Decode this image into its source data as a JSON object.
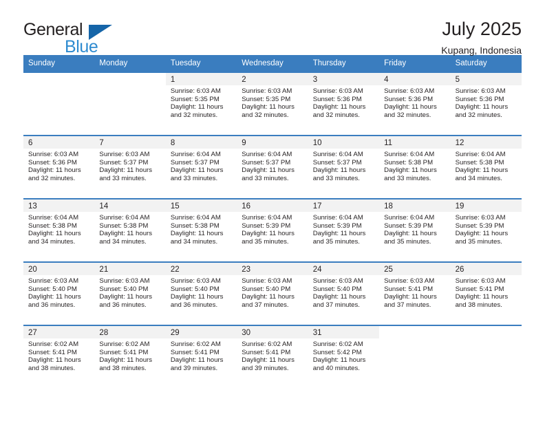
{
  "brand": {
    "name_part1": "General",
    "name_part2": "Blue",
    "triangle_color": "#1565a8",
    "blue_color": "#2e8bd0"
  },
  "header": {
    "title": "July 2025",
    "location": "Kupang, Indonesia"
  },
  "theme": {
    "header_band": "#3a7dbf",
    "row_divider": "#3a7dbf",
    "daynum_band": "#f2f2f2",
    "text": "#231f20"
  },
  "weekdays": [
    "Sunday",
    "Monday",
    "Tuesday",
    "Wednesday",
    "Thursday",
    "Friday",
    "Saturday"
  ],
  "weeks": [
    [
      {
        "empty": true
      },
      {
        "empty": true
      },
      {
        "day": "1",
        "sunrise": "Sunrise: 6:03 AM",
        "sunset": "Sunset: 5:35 PM",
        "daylight1": "Daylight: 11 hours",
        "daylight2": "and 32 minutes."
      },
      {
        "day": "2",
        "sunrise": "Sunrise: 6:03 AM",
        "sunset": "Sunset: 5:35 PM",
        "daylight1": "Daylight: 11 hours",
        "daylight2": "and 32 minutes."
      },
      {
        "day": "3",
        "sunrise": "Sunrise: 6:03 AM",
        "sunset": "Sunset: 5:36 PM",
        "daylight1": "Daylight: 11 hours",
        "daylight2": "and 32 minutes."
      },
      {
        "day": "4",
        "sunrise": "Sunrise: 6:03 AM",
        "sunset": "Sunset: 5:36 PM",
        "daylight1": "Daylight: 11 hours",
        "daylight2": "and 32 minutes."
      },
      {
        "day": "5",
        "sunrise": "Sunrise: 6:03 AM",
        "sunset": "Sunset: 5:36 PM",
        "daylight1": "Daylight: 11 hours",
        "daylight2": "and 32 minutes."
      }
    ],
    [
      {
        "day": "6",
        "sunrise": "Sunrise: 6:03 AM",
        "sunset": "Sunset: 5:36 PM",
        "daylight1": "Daylight: 11 hours",
        "daylight2": "and 32 minutes."
      },
      {
        "day": "7",
        "sunrise": "Sunrise: 6:03 AM",
        "sunset": "Sunset: 5:37 PM",
        "daylight1": "Daylight: 11 hours",
        "daylight2": "and 33 minutes."
      },
      {
        "day": "8",
        "sunrise": "Sunrise: 6:04 AM",
        "sunset": "Sunset: 5:37 PM",
        "daylight1": "Daylight: 11 hours",
        "daylight2": "and 33 minutes."
      },
      {
        "day": "9",
        "sunrise": "Sunrise: 6:04 AM",
        "sunset": "Sunset: 5:37 PM",
        "daylight1": "Daylight: 11 hours",
        "daylight2": "and 33 minutes."
      },
      {
        "day": "10",
        "sunrise": "Sunrise: 6:04 AM",
        "sunset": "Sunset: 5:37 PM",
        "daylight1": "Daylight: 11 hours",
        "daylight2": "and 33 minutes."
      },
      {
        "day": "11",
        "sunrise": "Sunrise: 6:04 AM",
        "sunset": "Sunset: 5:38 PM",
        "daylight1": "Daylight: 11 hours",
        "daylight2": "and 33 minutes."
      },
      {
        "day": "12",
        "sunrise": "Sunrise: 6:04 AM",
        "sunset": "Sunset: 5:38 PM",
        "daylight1": "Daylight: 11 hours",
        "daylight2": "and 34 minutes."
      }
    ],
    [
      {
        "day": "13",
        "sunrise": "Sunrise: 6:04 AM",
        "sunset": "Sunset: 5:38 PM",
        "daylight1": "Daylight: 11 hours",
        "daylight2": "and 34 minutes."
      },
      {
        "day": "14",
        "sunrise": "Sunrise: 6:04 AM",
        "sunset": "Sunset: 5:38 PM",
        "daylight1": "Daylight: 11 hours",
        "daylight2": "and 34 minutes."
      },
      {
        "day": "15",
        "sunrise": "Sunrise: 6:04 AM",
        "sunset": "Sunset: 5:38 PM",
        "daylight1": "Daylight: 11 hours",
        "daylight2": "and 34 minutes."
      },
      {
        "day": "16",
        "sunrise": "Sunrise: 6:04 AM",
        "sunset": "Sunset: 5:39 PM",
        "daylight1": "Daylight: 11 hours",
        "daylight2": "and 35 minutes."
      },
      {
        "day": "17",
        "sunrise": "Sunrise: 6:04 AM",
        "sunset": "Sunset: 5:39 PM",
        "daylight1": "Daylight: 11 hours",
        "daylight2": "and 35 minutes."
      },
      {
        "day": "18",
        "sunrise": "Sunrise: 6:04 AM",
        "sunset": "Sunset: 5:39 PM",
        "daylight1": "Daylight: 11 hours",
        "daylight2": "and 35 minutes."
      },
      {
        "day": "19",
        "sunrise": "Sunrise: 6:03 AM",
        "sunset": "Sunset: 5:39 PM",
        "daylight1": "Daylight: 11 hours",
        "daylight2": "and 35 minutes."
      }
    ],
    [
      {
        "day": "20",
        "sunrise": "Sunrise: 6:03 AM",
        "sunset": "Sunset: 5:40 PM",
        "daylight1": "Daylight: 11 hours",
        "daylight2": "and 36 minutes."
      },
      {
        "day": "21",
        "sunrise": "Sunrise: 6:03 AM",
        "sunset": "Sunset: 5:40 PM",
        "daylight1": "Daylight: 11 hours",
        "daylight2": "and 36 minutes."
      },
      {
        "day": "22",
        "sunrise": "Sunrise: 6:03 AM",
        "sunset": "Sunset: 5:40 PM",
        "daylight1": "Daylight: 11 hours",
        "daylight2": "and 36 minutes."
      },
      {
        "day": "23",
        "sunrise": "Sunrise: 6:03 AM",
        "sunset": "Sunset: 5:40 PM",
        "daylight1": "Daylight: 11 hours",
        "daylight2": "and 37 minutes."
      },
      {
        "day": "24",
        "sunrise": "Sunrise: 6:03 AM",
        "sunset": "Sunset: 5:40 PM",
        "daylight1": "Daylight: 11 hours",
        "daylight2": "and 37 minutes."
      },
      {
        "day": "25",
        "sunrise": "Sunrise: 6:03 AM",
        "sunset": "Sunset: 5:41 PM",
        "daylight1": "Daylight: 11 hours",
        "daylight2": "and 37 minutes."
      },
      {
        "day": "26",
        "sunrise": "Sunrise: 6:03 AM",
        "sunset": "Sunset: 5:41 PM",
        "daylight1": "Daylight: 11 hours",
        "daylight2": "and 38 minutes."
      }
    ],
    [
      {
        "day": "27",
        "sunrise": "Sunrise: 6:02 AM",
        "sunset": "Sunset: 5:41 PM",
        "daylight1": "Daylight: 11 hours",
        "daylight2": "and 38 minutes."
      },
      {
        "day": "28",
        "sunrise": "Sunrise: 6:02 AM",
        "sunset": "Sunset: 5:41 PM",
        "daylight1": "Daylight: 11 hours",
        "daylight2": "and 38 minutes."
      },
      {
        "day": "29",
        "sunrise": "Sunrise: 6:02 AM",
        "sunset": "Sunset: 5:41 PM",
        "daylight1": "Daylight: 11 hours",
        "daylight2": "and 39 minutes."
      },
      {
        "day": "30",
        "sunrise": "Sunrise: 6:02 AM",
        "sunset": "Sunset: 5:41 PM",
        "daylight1": "Daylight: 11 hours",
        "daylight2": "and 39 minutes."
      },
      {
        "day": "31",
        "sunrise": "Sunrise: 6:02 AM",
        "sunset": "Sunset: 5:42 PM",
        "daylight1": "Daylight: 11 hours",
        "daylight2": "and 40 minutes."
      },
      {
        "empty": true
      },
      {
        "empty": true
      }
    ]
  ]
}
